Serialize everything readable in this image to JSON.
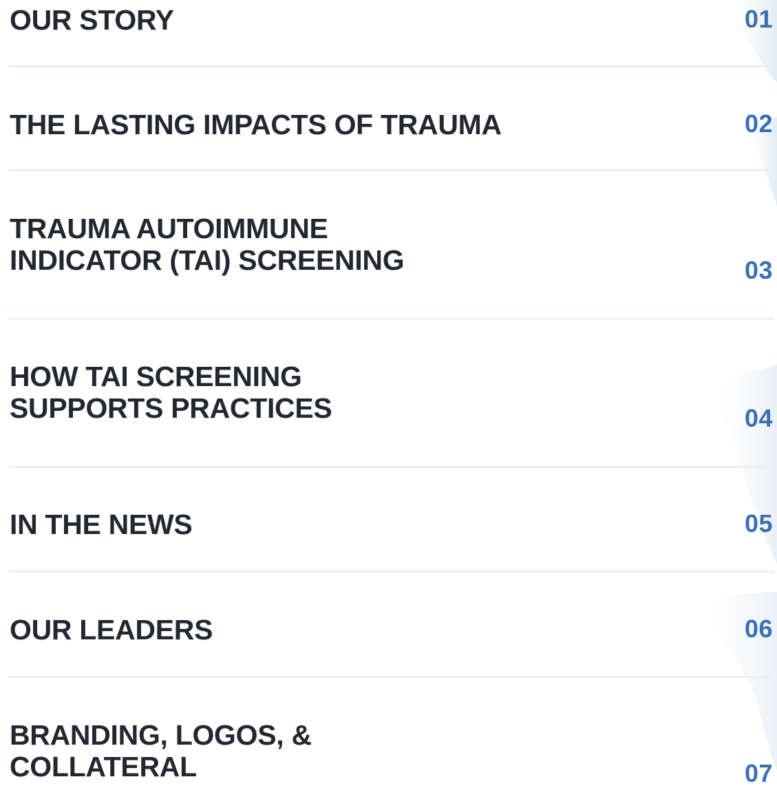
{
  "accent_color": "#3a6fb3",
  "text_color": "#222731",
  "divider_color": "#e8f0f6",
  "toc": {
    "items": [
      {
        "title": "OUR STORY",
        "number": "01"
      },
      {
        "title": "THE LASTING IMPACTS OF TRAUMA",
        "number": "02"
      },
      {
        "title": "TRAUMA AUTOIMMUNE\nINDICATOR (TAI) SCREENING",
        "number": "03"
      },
      {
        "title": "HOW TAI SCREENING\nSUPPORTS PRACTICES",
        "number": "04"
      },
      {
        "title": "IN THE NEWS",
        "number": "05"
      },
      {
        "title": "OUR LEADERS",
        "number": "06"
      },
      {
        "title": "BRANDING, LOGOS, &\nCOLLATERAL",
        "number": "07"
      }
    ]
  }
}
